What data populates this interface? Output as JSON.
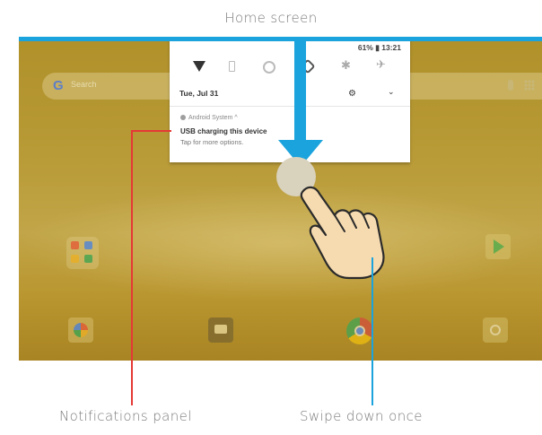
{
  "captions": {
    "top": "Home screen",
    "left": "Notifications panel",
    "right": "Swipe down once"
  },
  "home_screen": {
    "search_placeholder": "Search",
    "icons": [
      "google-g-icon",
      "mic-icon",
      "apps-grid-icon",
      "app-folder-icon",
      "play-store-icon",
      "photos-icon",
      "messages-icon",
      "chrome-icon",
      "camera-icon"
    ]
  },
  "notification_panel": {
    "status": "61% ▮ 13:21",
    "date": "Tue, Jul 31",
    "quick_settings": [
      "wifi-icon",
      "battery-saver-icon",
      "do-not-disturb-icon",
      "auto-rotate-icon",
      "bluetooth-icon",
      "airplane-mode-icon"
    ],
    "notification": {
      "source": "Android System ^",
      "title": "USB charging this device",
      "body": "Tap for more options."
    }
  },
  "colors": {
    "arrow": "#1aa3dd",
    "leader_red": "#e53935",
    "leader_blue": "#1aa3dd"
  }
}
